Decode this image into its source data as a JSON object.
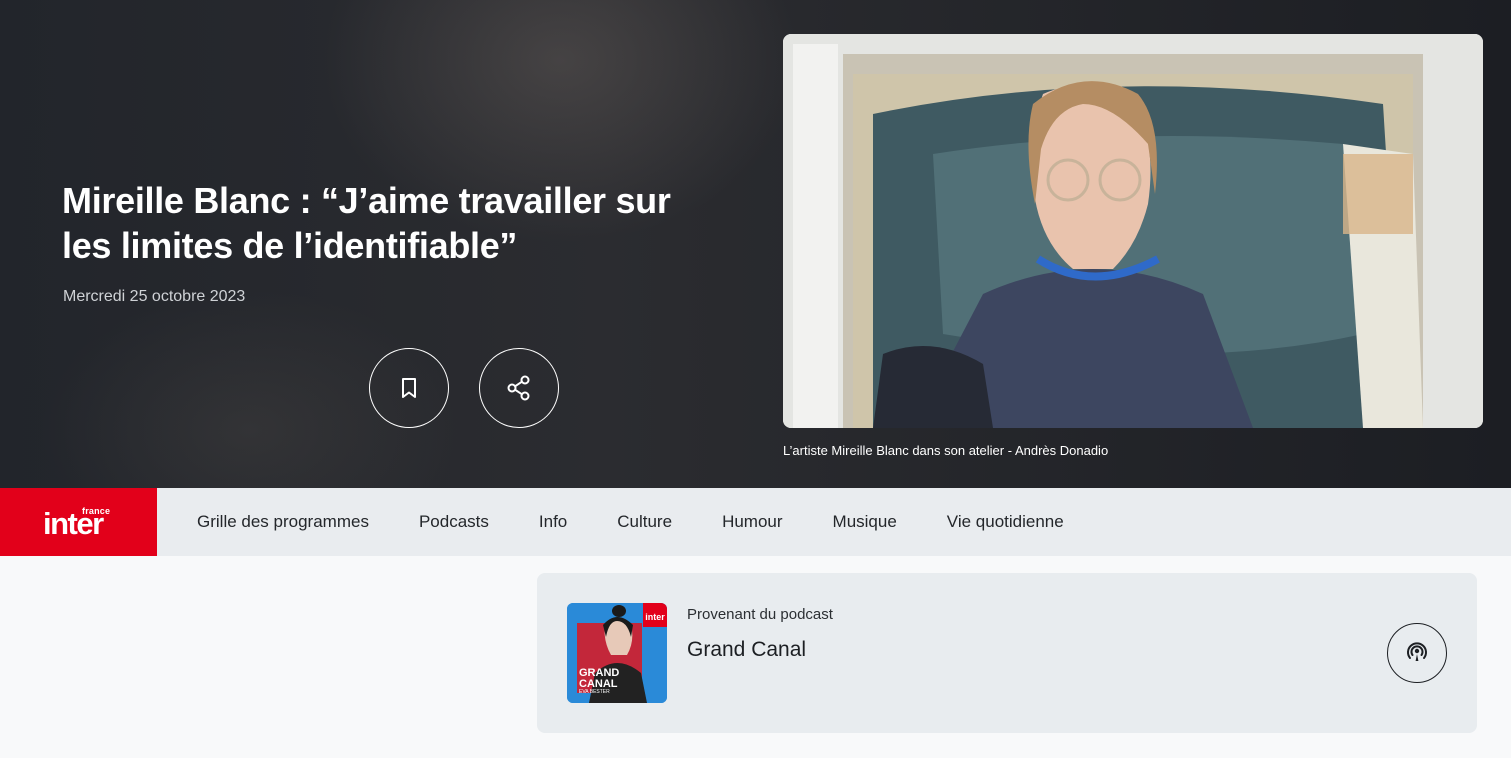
{
  "hero": {
    "title": "Mireille Blanc : “J’aime travailler sur les limites de l’identifiable”",
    "date": "Mercredi 25 octobre 2023",
    "caption": "L’artiste Mireille Blanc dans son atelier - Andrès Donadio",
    "bookmark_icon": "bookmark-icon",
    "share_icon": "share-icon"
  },
  "nav": {
    "logo_small": "france",
    "logo_main": "inter",
    "items": [
      {
        "label": "Grille des programmes"
      },
      {
        "label": "Podcasts"
      },
      {
        "label": "Info"
      },
      {
        "label": "Culture"
      },
      {
        "label": "Humour"
      },
      {
        "label": "Musique"
      },
      {
        "label": "Vie quotidienne"
      }
    ]
  },
  "podcast_card": {
    "label": "Provenant du podcast",
    "title": "Grand Canal",
    "thumb_brand": "inter",
    "thumb_title_1": "GRAND",
    "thumb_title_2": "CANAL",
    "thumb_host": "EVA BESTER",
    "action_icon": "podcast-icon"
  },
  "colors": {
    "brand_red": "#e2001a",
    "nav_bg": "#e9ecef",
    "card_bg": "#e8ecef"
  }
}
